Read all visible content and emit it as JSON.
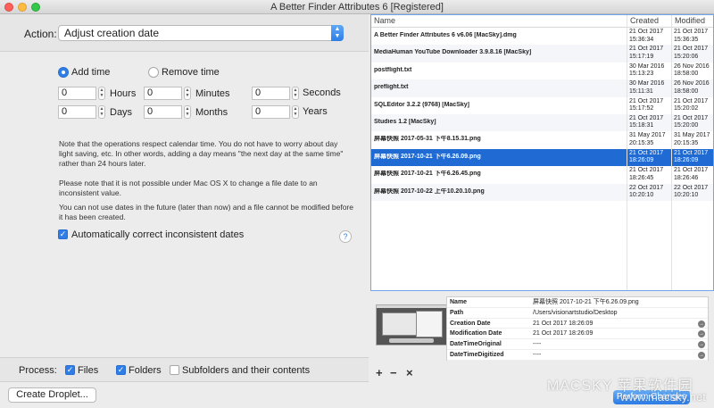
{
  "window": {
    "title": "A Better Finder Attributes 6 [Registered]"
  },
  "action": {
    "label": "Action:",
    "value": "Adjust creation date"
  },
  "options": {
    "add_time": "Add time",
    "remove_time": "Remove time",
    "fields": {
      "hours": {
        "value": "0",
        "label": "Hours"
      },
      "minutes": {
        "value": "0",
        "label": "Minutes"
      },
      "seconds": {
        "value": "0",
        "label": "Seconds"
      },
      "days": {
        "value": "0",
        "label": "Days"
      },
      "months": {
        "value": "0",
        "label": "Months"
      },
      "years": {
        "value": "0",
        "label": "Years"
      }
    },
    "note1": "Note that the operations respect calendar time. You do not have to worry about day light saving, etc. In other words, adding a day means \"the next day at the same time\" rather than 24 hours later.",
    "note2": "Please note that it is not possible under Mac OS X to change a file date to an inconsistent value.",
    "note3": "You can not use dates in the future (later than now) and a file cannot be modified before it has been created.",
    "auto_correct": "Automatically correct inconsistent dates",
    "help": "?"
  },
  "process": {
    "label": "Process:",
    "files": "Files",
    "folders": "Folders",
    "subfolders": "Subfolders and their contents"
  },
  "create_droplet": "Create Droplet...",
  "table": {
    "headers": {
      "name": "Name",
      "created": "Created",
      "modified": "Modified"
    },
    "rows": [
      {
        "name": "A Better Finder Attributes 6 v6.06 [MacSky].dmg",
        "created_date": "21 Oct 2017",
        "created_time": "15:36:34",
        "mod_date": "21 Oct 2017",
        "mod_time": "15:36:35"
      },
      {
        "name": "MediaHuman YouTube Downloader 3.9.8.16 [MacSky]",
        "created_date": "21 Oct 2017",
        "created_time": "15:17:19",
        "mod_date": "21 Oct 2017",
        "mod_time": "15:20:06"
      },
      {
        "name": "postflight.txt",
        "created_date": "30 Mar 2016",
        "created_time": "15:13:23",
        "mod_date": "26 Nov 2016",
        "mod_time": "18:58:00"
      },
      {
        "name": "preflight.txt",
        "created_date": "30 Mar 2016",
        "created_time": "15:11:31",
        "mod_date": "26 Nov 2016",
        "mod_time": "18:58:00"
      },
      {
        "name": "SQLEditor 3.2.2 (9768) [MacSky]",
        "created_date": "21 Oct 2017",
        "created_time": "15:17:52",
        "mod_date": "21 Oct 2017",
        "mod_time": "15:20:02"
      },
      {
        "name": "Studies 1.2 [MacSky]",
        "created_date": "21 Oct 2017",
        "created_time": "15:18:31",
        "mod_date": "21 Oct 2017",
        "mod_time": "15:20:00"
      },
      {
        "name": "屏幕快照 2017-05-31 下午8.15.31.png",
        "created_date": "31 May 2017",
        "created_time": "20:15:35",
        "mod_date": "31 May 2017",
        "mod_time": "20:15:35"
      },
      {
        "name": "屏幕快照 2017-10-21 下午6.26.09.png",
        "created_date": "21 Oct 2017",
        "created_time": "18:26:09",
        "mod_date": "21 Oct 2017",
        "mod_time": "18:26:09"
      },
      {
        "name": "屏幕快照 2017-10-21 下午6.26.45.png",
        "created_date": "21 Oct 2017",
        "created_time": "18:26:45",
        "mod_date": "21 Oct 2017",
        "mod_time": "18:26:46"
      },
      {
        "name": "屏幕快照 2017-10-22 上午10.20.10.png",
        "created_date": "22 Oct 2017",
        "created_time": "10:20:10",
        "mod_date": "22 Oct 2017",
        "mod_time": "10:20:10"
      }
    ],
    "selected_index": 7
  },
  "metadata": {
    "rows": [
      {
        "name": "Name",
        "value": "屏幕快照 2017-10-21 下午6.26.09.png",
        "arrow": false
      },
      {
        "name": "Path",
        "value": "/Users/visionartstudio/Desktop",
        "arrow": false
      },
      {
        "name": "Creation Date",
        "value": "21 Oct 2017 18:26:09",
        "arrow": true
      },
      {
        "name": "Modification Date",
        "value": "21 Oct 2017 18:26:09",
        "arrow": true
      },
      {
        "name": "DateTimeOriginal",
        "value": "----",
        "arrow": true
      },
      {
        "name": "DateTimeDigitized",
        "value": "----",
        "arrow": true
      }
    ]
  },
  "toolbar": {
    "add": "+",
    "remove": "−",
    "clear": "×"
  },
  "perform_button": "Perform Changes",
  "watermark": {
    "line1": "MACSKY 苹果软件园",
    "line2": "www.macsky.net"
  }
}
